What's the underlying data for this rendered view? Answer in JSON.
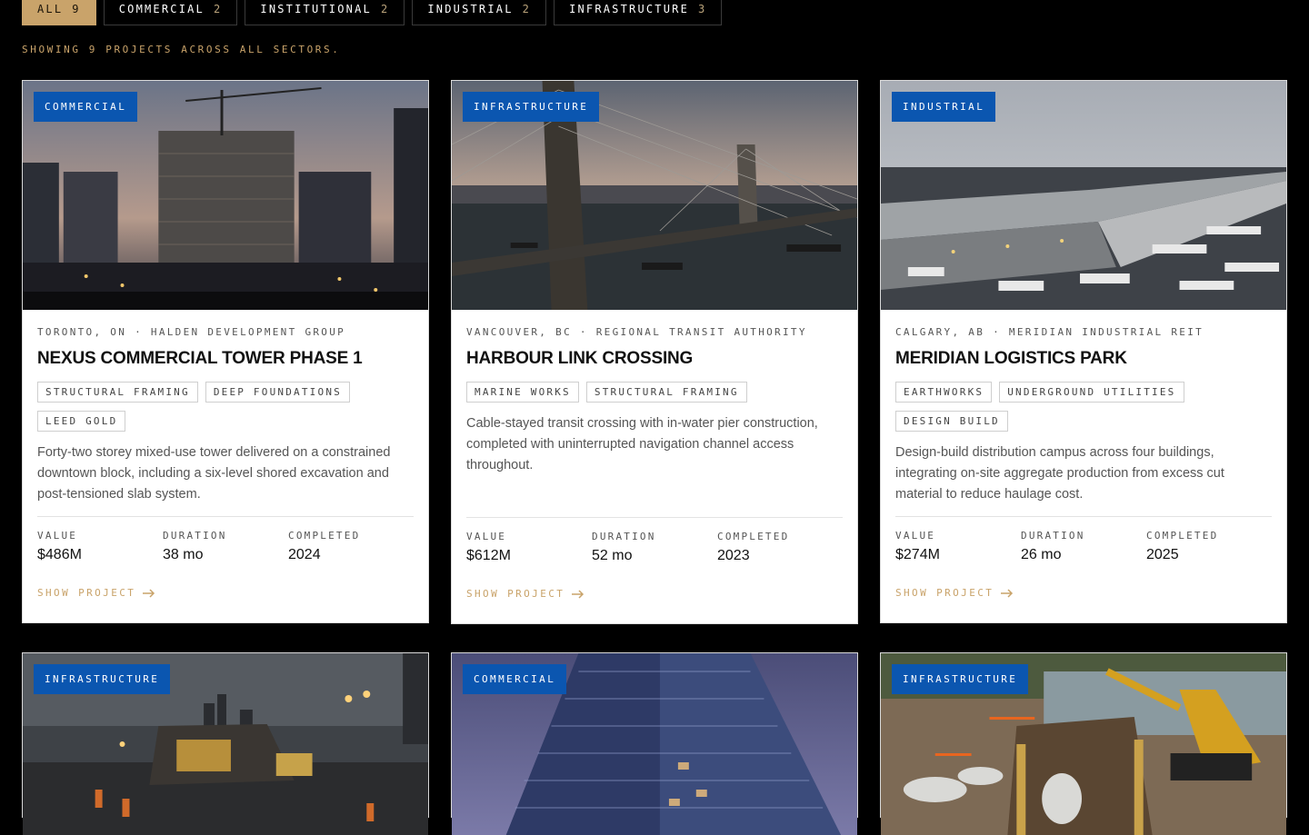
{
  "filters": [
    {
      "label": "ALL",
      "count": "9"
    },
    {
      "label": "COMMERCIAL",
      "count": "2"
    },
    {
      "label": "INSTITUTIONAL",
      "count": "2"
    },
    {
      "label": "INDUSTRIAL",
      "count": "2"
    },
    {
      "label": "INFRASTRUCTURE",
      "count": "3"
    }
  ],
  "showing_text": "SHOWING 9 PROJECTS ACROSS ALL SECTORS.",
  "labels": {
    "value": "VALUE",
    "duration": "DURATION",
    "completed": "COMPLETED",
    "show_project": "SHOW PROJECT"
  },
  "projects": [
    {
      "category": "COMMERCIAL",
      "meta": "TORONTO, ON · HALDEN DEVELOPMENT GROUP",
      "title": "NEXUS COMMERCIAL TOWER PHASE 1",
      "tags": [
        "STRUCTURAL FRAMING",
        "DEEP FOUNDATIONS",
        "LEED GOLD"
      ],
      "description": "Forty-two storey mixed-use tower delivered on a constrained downtown block, including a six-level shored excavation and post-tensioned slab system.",
      "value": "$486M",
      "duration": "38 mo",
      "completed": "2024"
    },
    {
      "category": "INFRASTRUCTURE",
      "meta": "VANCOUVER, BC · REGIONAL TRANSIT AUTHORITY",
      "title": "HARBOUR LINK CROSSING",
      "tags": [
        "MARINE WORKS",
        "STRUCTURAL FRAMING"
      ],
      "description": "Cable-stayed transit crossing with in-water pier construction, completed with uninterrupted navigation channel access throughout.",
      "value": "$612M",
      "duration": "52 mo",
      "completed": "2023"
    },
    {
      "category": "INDUSTRIAL",
      "meta": "CALGARY, AB · MERIDIAN INDUSTRIAL REIT",
      "title": "MERIDIAN LOGISTICS PARK",
      "tags": [
        "EARTHWORKS",
        "UNDERGROUND UTILITIES",
        "DESIGN BUILD"
      ],
      "description": "Design-build distribution campus across four buildings, integrating on-site aggregate production from excess cut material to reduce haulage cost.",
      "value": "$274M",
      "duration": "26 mo",
      "completed": "2025"
    },
    {
      "category": "INFRASTRUCTURE"
    },
    {
      "category": "COMMERCIAL"
    },
    {
      "category": "INFRASTRUCTURE"
    }
  ],
  "colors": {
    "accent": "#c9a36a",
    "badge": "#0b56b0",
    "background": "#000000"
  }
}
